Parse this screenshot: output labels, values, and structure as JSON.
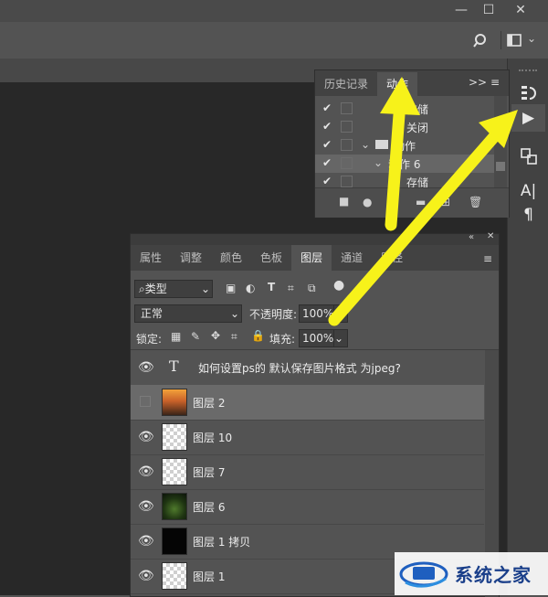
{
  "colors": {
    "arrow": "#f7f21a",
    "selected_row": "#6a6a6a",
    "panel": "#535353",
    "canvas": "#282828",
    "watermark_blue": "#1f5fbf"
  },
  "window": {
    "minimize": "—",
    "maximize": "☐",
    "close": "✕"
  },
  "actions_panel": {
    "tabs": [
      "历史记录",
      "动作"
    ],
    "menu_icons": [
      ">>",
      "≡"
    ],
    "rows": [
      {
        "checked": true,
        "label": "存储"
      },
      {
        "checked": true,
        "label": "关闭"
      },
      {
        "checked": true,
        "label": "动作"
      },
      {
        "checked": true,
        "label": "动作 6"
      },
      {
        "checked": true,
        "label": "存储"
      }
    ]
  },
  "layers_panel": {
    "tabs": [
      "属性",
      "调整",
      "颜色",
      "色板",
      "图层",
      "通道",
      "路径"
    ],
    "filter_kind": "类型",
    "blend_mode": "正常",
    "opacity_label": "不透明度:",
    "opacity_value": "100%",
    "lock_label": "锁定:",
    "fill_label": "填充:",
    "fill_value": "100%",
    "layers": [
      {
        "name": "如何设置ps的 默认保存图片格式 为jpeg?",
        "type": "text",
        "visible": true,
        "selected": false
      },
      {
        "name": "图层 2",
        "type": "photo",
        "visible": false,
        "selected": true
      },
      {
        "name": "图层 10",
        "type": "flower",
        "visible": true,
        "selected": false
      },
      {
        "name": "图层 7",
        "type": "flower",
        "visible": true,
        "selected": false
      },
      {
        "name": "图层 6",
        "type": "green",
        "visible": true,
        "selected": false
      },
      {
        "name": "图层 1 拷贝",
        "type": "black",
        "visible": true,
        "selected": false
      },
      {
        "name": "图层 1",
        "type": "transparent",
        "visible": true,
        "selected": false
      }
    ]
  },
  "watermark": {
    "text": "系统之家"
  }
}
